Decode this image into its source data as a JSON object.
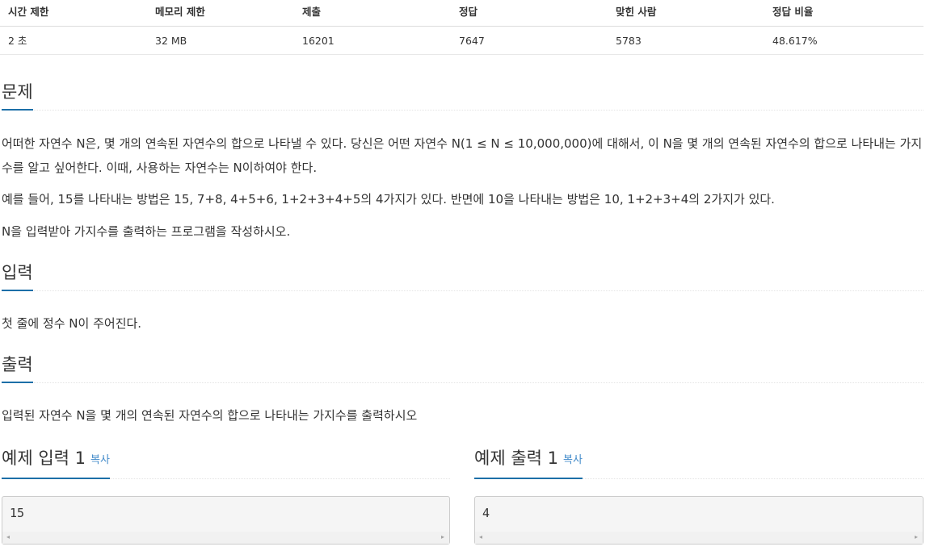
{
  "stats": {
    "headers": [
      "시간 제한",
      "메모리 제한",
      "제출",
      "정답",
      "맞힌 사람",
      "정답 비율"
    ],
    "values": [
      "2 초",
      "32 MB",
      "16201",
      "7647",
      "5783",
      "48.617%"
    ]
  },
  "problem": {
    "title": "문제",
    "paragraphs": [
      "어떠한 자연수 N은, 몇 개의 연속된 자연수의 합으로 나타낼 수 있다. 당신은 어떤 자연수 N(1 ≤ N ≤ 10,000,000)에 대해서, 이 N을 몇 개의 연속된 자연수의 합으로 나타내는 가지수를 알고 싶어한다. 이때, 사용하는 자연수는 N이하여야 한다.",
      "예를 들어, 15를 나타내는 방법은 15, 7+8, 4+5+6, 1+2+3+4+5의 4가지가 있다. 반면에 10을 나타내는 방법은 10, 1+2+3+4의 2가지가 있다.",
      "N을 입력받아 가지수를 출력하는 프로그램을 작성하시오."
    ]
  },
  "input": {
    "title": "입력",
    "text": "첫 줄에 정수 N이 주어진다."
  },
  "output": {
    "title": "출력",
    "text": "입력된 자연수 N을 몇 개의 연속된 자연수의 합으로 나타내는 가지수를 출력하시오"
  },
  "samples": {
    "input": {
      "title": "예제 입력 1",
      "copy_label": "복사",
      "value": "15"
    },
    "output": {
      "title": "예제 출력 1",
      "copy_label": "복사",
      "value": "4"
    }
  },
  "icons": {
    "scroll_left": "◂",
    "scroll_right": "▸"
  },
  "colors": {
    "accent_underline": "#1c6fa8",
    "copy_link": "#428bca",
    "sample_bg": "#f5f5f5"
  }
}
